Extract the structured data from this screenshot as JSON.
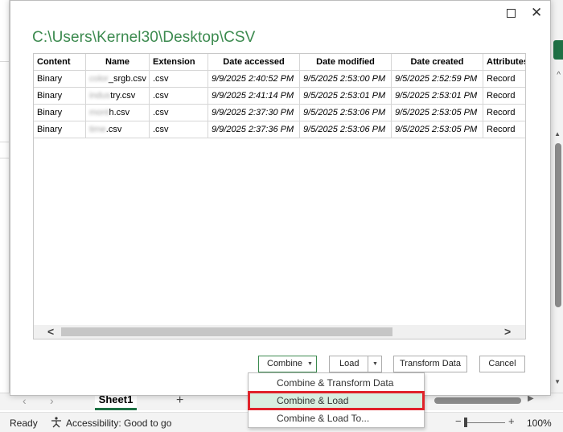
{
  "dialog": {
    "title_path": "C:\\Users\\Kernel30\\Desktop\\CSV",
    "columns": [
      "Content",
      "Name",
      "Extension",
      "Date accessed",
      "Date modified",
      "Date created",
      "Attributes"
    ],
    "rows": [
      {
        "content": "Binary",
        "name_blurred": "color",
        "name_visible": "_srgb.csv",
        "extension": ".csv",
        "date_accessed": "9/9/2025 2:40:52 PM",
        "date_modified": "9/5/2025 2:53:00 PM",
        "date_created": "9/5/2025 2:52:59 PM",
        "attributes": "Record"
      },
      {
        "content": "Binary",
        "name_blurred": "indus",
        "name_visible": "try.csv",
        "extension": ".csv",
        "date_accessed": "9/9/2025 2:41:14 PM",
        "date_modified": "9/5/2025 2:53:01 PM",
        "date_created": "9/5/2025 2:53:01 PM",
        "attributes": "Record"
      },
      {
        "content": "Binary",
        "name_blurred": "mont",
        "name_visible": "h.csv",
        "extension": ".csv",
        "date_accessed": "9/9/2025 2:37:30 PM",
        "date_modified": "9/5/2025 2:53:06 PM",
        "date_created": "9/5/2025 2:53:05 PM",
        "attributes": "Record"
      },
      {
        "content": "Binary",
        "name_blurred": "time",
        "name_visible": ".csv",
        "extension": ".csv",
        "date_accessed": "9/9/2025 2:37:36 PM",
        "date_modified": "9/5/2025 2:53:06 PM",
        "date_created": "9/5/2025 2:53:05 PM",
        "attributes": "Record"
      }
    ],
    "buttons": {
      "combine": "Combine",
      "load": "Load",
      "transform": "Transform Data",
      "cancel": "Cancel"
    },
    "combine_menu": [
      {
        "label": "Combine & Transform Data",
        "selected": false
      },
      {
        "label": "Combine & Load",
        "selected": true
      },
      {
        "label": "Combine & Load To...",
        "selected": false
      }
    ]
  },
  "excel": {
    "sheet_tab": "Sheet1",
    "status": "Ready",
    "accessibility": "Accessibility: Good to go",
    "zoom": "100%"
  },
  "colors": {
    "path_green": "#3c8a4f",
    "highlight_red": "#e0232a",
    "menu_selected_bg": "#d9efe0",
    "excel_green": "#1e7145"
  },
  "icons": {
    "close": "close-icon",
    "maximize": "maximize-icon",
    "accessibility": "accessibility-icon",
    "scroll_left": "chevron-left-icon",
    "scroll_right": "chevron-right-icon",
    "dropdown": "caret-down-icon"
  }
}
